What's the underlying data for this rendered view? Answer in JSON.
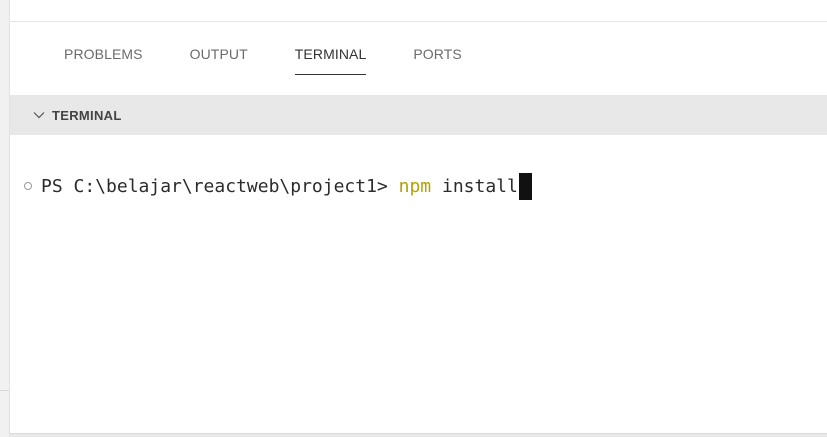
{
  "panel": {
    "tabs": [
      {
        "label": "PROBLEMS",
        "active": false
      },
      {
        "label": "OUTPUT",
        "active": false
      },
      {
        "label": "TERMINAL",
        "active": true
      },
      {
        "label": "PORTS",
        "active": false
      }
    ]
  },
  "section": {
    "title": "TERMINAL",
    "icon": "chevron-down-icon"
  },
  "terminal": {
    "prompt": "PS C:\\belajar\\reactweb\\project1> ",
    "command": "npm",
    "arguments": " install",
    "status_icon": "circle-outline-icon"
  },
  "colors": {
    "command": "#b5a000",
    "section_bg": "#e8e8e8",
    "active_tab_underline": "#333333"
  }
}
